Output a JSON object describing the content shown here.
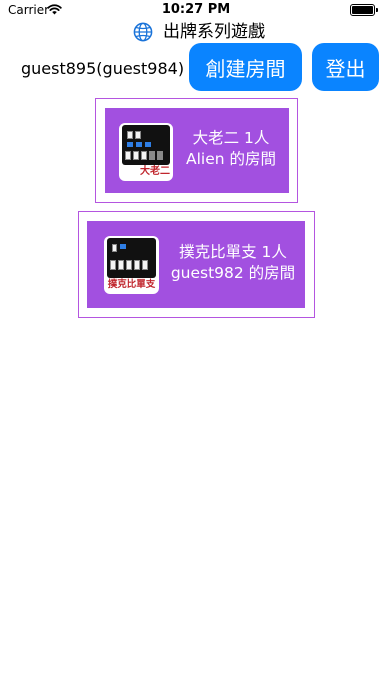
{
  "status_bar": {
    "carrier": "Carrier",
    "time": "10:27 PM",
    "battery_level": 1.0
  },
  "header": {
    "title": "出牌系列遊戲",
    "icon": "globe-icon"
  },
  "user": {
    "display_name": "guest895(guest984)"
  },
  "buttons": {
    "create_room": "創建房間",
    "logout": "登出"
  },
  "rooms": [
    {
      "game": "大老二 1人",
      "owner": "Alien 的房間",
      "thumb_label": "大老二",
      "thumb_icon": "big-two-game-icon"
    },
    {
      "game": "撲克比單支 1人",
      "owner": "guest982 的房間",
      "thumb_label": "撲克比單支",
      "thumb_icon": "poker-single-game-icon"
    }
  ],
  "colors": {
    "accent_button": "#0a84ff",
    "room_fill": "#a250e0",
    "room_border": "#b455e0",
    "thumb_label": "#c0262d"
  }
}
